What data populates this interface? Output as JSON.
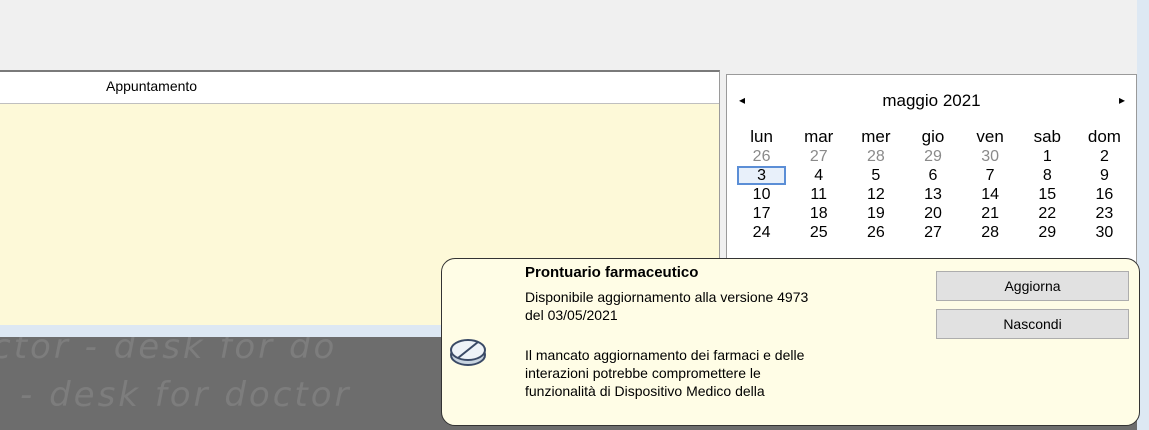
{
  "appointments": {
    "column_header": "Appuntamento"
  },
  "calendar": {
    "month_title": "maggio 2021",
    "prev_glyph": "◂",
    "next_glyph": "▸",
    "weekdays": [
      "lun",
      "mar",
      "mer",
      "gio",
      "ven",
      "sab",
      "dom"
    ],
    "weeks": [
      [
        "26",
        "27",
        "28",
        "29",
        "30",
        "1",
        "2"
      ],
      [
        "3",
        "4",
        "5",
        "6",
        "7",
        "8",
        "9"
      ],
      [
        "10",
        "11",
        "12",
        "13",
        "14",
        "15",
        "16"
      ],
      [
        "17",
        "18",
        "19",
        "20",
        "21",
        "22",
        "23"
      ],
      [
        "24",
        "25",
        "26",
        "27",
        "28",
        "29",
        "30"
      ]
    ],
    "selected_day": "3",
    "other_month_days_first_week": 5
  },
  "watermark": {
    "line1": "ctor - desk for do",
    "line2": "- desk for doctor"
  },
  "popup": {
    "title": "Prontuario farmaceutico",
    "line1": "Disponibile aggiornamento alla versione 4973",
    "line2": "del 03/05/2021",
    "line3": "Il mancato aggiornamento dei farmaci e delle",
    "line4": "interazioni potrebbe compromettere le",
    "line5": "funzionalità di Dispositivo Medico della",
    "update_button": "Aggiorna",
    "hide_button": "Nascondi",
    "icon": "pill-icon"
  },
  "colors": {
    "appointment_bg": "#fdf9d8",
    "popup_bg": "#fffde6",
    "selected_day_border": "#5b8ed6"
  }
}
